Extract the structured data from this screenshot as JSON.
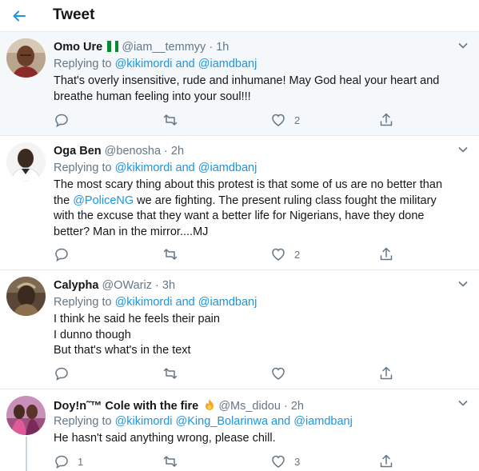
{
  "header": {
    "title": "Tweet"
  },
  "colors": {
    "accent": "#1b95e0",
    "muted": "#657786",
    "highlight_bg": "#f5f8fa",
    "flag_green": "#0a8a2e",
    "fire": "#f5a623"
  },
  "tweets": [
    {
      "name": "Omo Ure",
      "flag": "nigeria-flag-emoji",
      "handle": "@iam__temmyy",
      "sep": "·",
      "time": "1h",
      "replying_prefix": "Replying to",
      "replying_to": "@kikimordi and @iamdbanj",
      "text_lines": [
        "That's overly insensitive, rude and inhumane! May God heal your heart and",
        "breathe human feeling into your soul!!!"
      ],
      "reply_count": "",
      "retweet_count": "",
      "like_count": "2"
    },
    {
      "name": "Oga Ben",
      "handle": "@benosha",
      "sep": "·",
      "time": "2h",
      "replying_prefix": "Replying to",
      "replying_to": "@kikimordi and @iamdbanj",
      "text_line1": "The most scary thing about this protest is that some of us are no better than",
      "text_line2_pre": "the ",
      "text_line2_mention": "@PoliceNG",
      "text_line2_post": " we are fighting. The present ruling class fought the military",
      "text_line3": "with the excuse that they want a better life for Nigerians, have they done",
      "text_line4": "better? Man in the mirror....MJ",
      "reply_count": "",
      "retweet_count": "",
      "like_count": "2"
    },
    {
      "name": "Calypha",
      "handle": "@OWariz",
      "sep": "·",
      "time": "3h",
      "replying_prefix": "Replying to",
      "replying_to": "@kikimordi and @iamdbanj",
      "text_lines": [
        "I think he said he feels their pain",
        "I dunno though",
        "But that's what's in the text"
      ],
      "reply_count": "",
      "retweet_count": "",
      "like_count": ""
    },
    {
      "name": "Doy!n˜™ Cole with the fire",
      "emoji": "fire-emoji",
      "handle": "@Ms_didou",
      "sep": "·",
      "time": "2h",
      "replying_prefix": "Replying to",
      "replying_to": "@kikimordi @King_Bolarinwa and @iamdbanj",
      "text_lines": [
        "He hasn't said anything wrong, please chill."
      ],
      "reply_count": "1",
      "retweet_count": "",
      "like_count": "3"
    }
  ]
}
